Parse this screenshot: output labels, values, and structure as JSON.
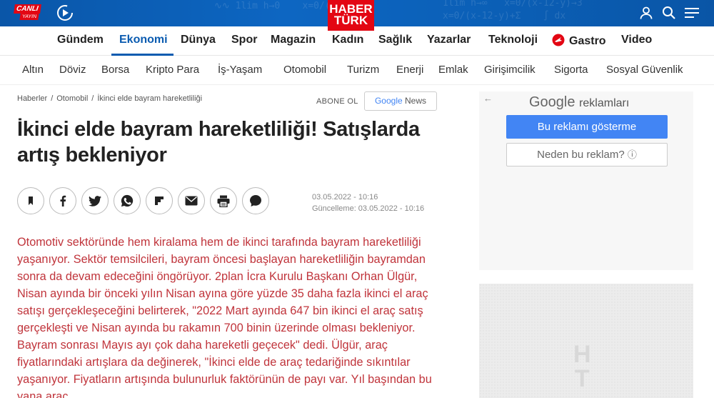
{
  "topbar": {
    "live_line1": "CANLI",
    "live_line2": "YAYIN",
    "logo_line1": "HABER",
    "logo_line2": "TÜRK",
    "brand_color": "#e30613",
    "bar_color": "#0b5fb6"
  },
  "main_nav": {
    "items": [
      "Gündem",
      "Ekonomi",
      "Dünya",
      "Spor",
      "Magazin",
      "Kadın",
      "Sağlık",
      "Yazarlar",
      "Teknoloji",
      "Gastro",
      "Video"
    ],
    "active": "Ekonomi",
    "active_color": "#0a5bb0"
  },
  "sub_nav": {
    "items": [
      "Altın",
      "Döviz",
      "Borsa",
      "Kripto Para",
      "İş-Yaşam",
      "Otomobil",
      "Turizm",
      "Enerji",
      "Emlak",
      "Girişimcilik",
      "Sigorta",
      "Sosyal Güvenlik"
    ]
  },
  "breadcrumb": {
    "items": [
      "Haberler",
      "Otomobil",
      "İkinci elde bayram hareketliliği"
    ]
  },
  "subscribe": {
    "label": "ABONE OL",
    "google_news_label_1": "Google",
    "google_news_label_2": "News"
  },
  "article": {
    "title": "İkinci elde bayram hareketliliği! Satışlarda artış bekleniyor",
    "published": "03.05.2022 - 10:16",
    "updated": "Güncelleme: 03.05.2022 - 10:16",
    "body": "Otomotiv sektöründe hem kiralama hem de ikinci tarafında bayram hareketliliği yaşanıyor. Sektör temsilcileri, bayram öncesi başlayan hareketliliğin bayramdan sonra da devam edeceğini öngörüyor. 2plan İcra Kurulu Başkanı Orhan Ülgür, Nisan ayında bir önceki yılın Nisan ayına göre yüzde 35 daha fazla ikinci el araç satışı gerçekleşeceğini belirterek, \"2022 Mart ayında 647 bin ikinci el araç satış gerçekleşti ve Nisan ayında bu rakamın 700 binin üzerinde olması bekleniyor. Bayram sonrası Mayıs ayı çok daha hareketli geçecek\" dedi. Ülgür, araç fiyatlarındaki artışlara da değinerek, \"İkinci elde de araç tedariğinde sıkıntılar yaşanıyor. Fiyatların artışında bulunurluk faktörünün de payı var. Yıl başından bu yana araç",
    "text_color": "#c0343b"
  },
  "share_buttons": [
    "bookmark-icon",
    "facebook-icon",
    "twitter-icon",
    "whatsapp-icon",
    "flipboard-icon",
    "mail-icon",
    "print-icon",
    "comment-icon"
  ],
  "ad": {
    "google_label": "Google",
    "ads_label": "reklamları",
    "stop_label": "Bu reklamı gösterme",
    "why_label": "Neden bu reklam?",
    "button_color": "#4285f4"
  },
  "placeholder_ad": {
    "watermark": "H T"
  }
}
